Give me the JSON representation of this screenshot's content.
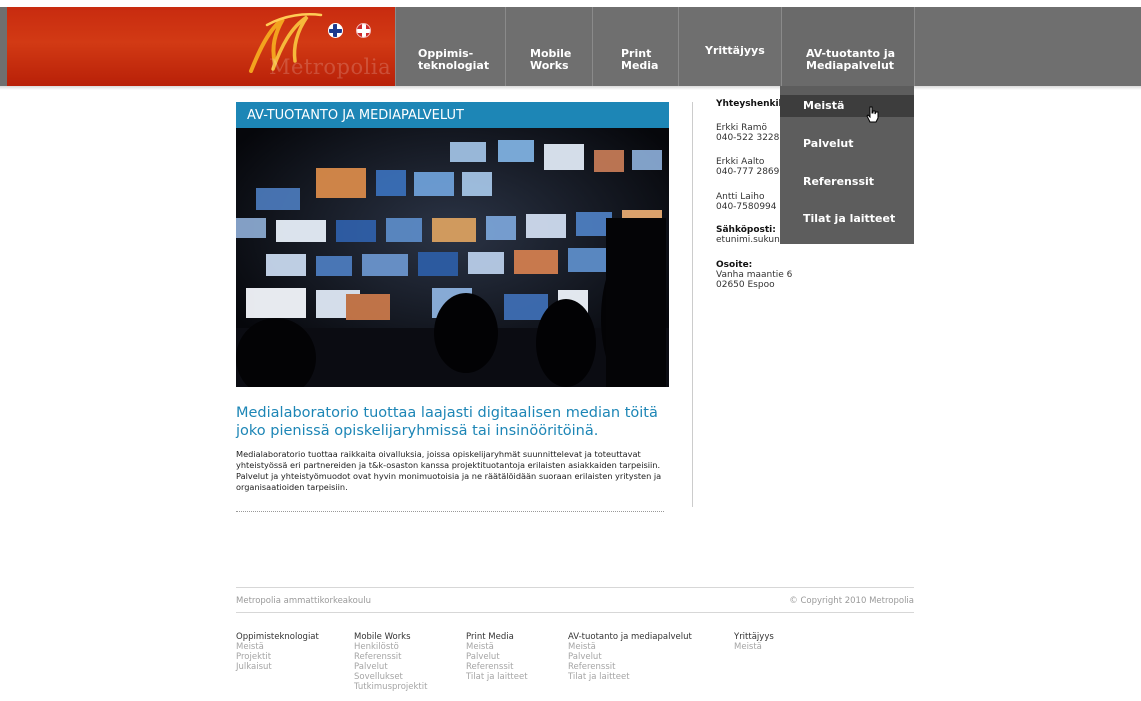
{
  "brand": {
    "logo_text": "Metropolia"
  },
  "languages": [
    {
      "name": "finnish-flag"
    },
    {
      "name": "english-flag"
    }
  ],
  "nav": {
    "items": [
      {
        "label": "Oppimis-\nteknologiat"
      },
      {
        "label": "Mobile\nWorks"
      },
      {
        "label": "Print\nMedia"
      },
      {
        "label": "Yrittäjyys"
      },
      {
        "label": "AV-tuotanto ja\nMediapalvelut"
      }
    ]
  },
  "dropdown": {
    "items": [
      {
        "label": "Meistä",
        "active": true
      },
      {
        "label": "Palvelut"
      },
      {
        "label": "Referenssit"
      },
      {
        "label": "Tilat ja laitteet"
      }
    ]
  },
  "main": {
    "section_title": "AV-TUOTANTO JA MEDIAPALVELUT",
    "lead": "Medialaboratorio tuottaa laajasti digitaalisen median töitä joko pienissä opiskelijaryhmissä tai insinööritöinä.",
    "body": "Medialaboratorio tuottaa raikkaita oivalluksia, joissa opiskelijaryhmät suunnittelevat ja toteuttavat yhteistyössä eri partnereiden ja t&k-osaston kanssa projektituotantoja erilaisten asiakkaiden tarpeisiin. Palvelut ja yhteistyömuodot ovat hyvin monimuotoisia ja ne räätälöidään suoraan erilaisten yritysten ja organisaatioiden tarpeisiin."
  },
  "contacts": {
    "heading": "Yhteyshenkilöt:",
    "people": [
      {
        "name": "Erkki Ramö",
        "phone": "040-522 3228"
      },
      {
        "name": "Erkki Aalto",
        "phone": "040-777 2869"
      },
      {
        "name": "Antti Laiho",
        "phone": "040-7580994"
      }
    ],
    "email_label": "Sähköposti:",
    "email": "etunimi.sukunimi@metropolia.fi",
    "address_label": "Osoite:",
    "address_line1": "Vanha maantie 6",
    "address_line2": "02650 Espoo"
  },
  "footer": {
    "org": "Metropolia ammattikorkeakoulu",
    "copyright": "© Copyright 2010 Metropolia",
    "columns": [
      {
        "heading": "Oppimisteknologiat",
        "links": [
          "Meistä",
          "Projektit",
          "Julkaisut"
        ]
      },
      {
        "heading": "Mobile Works",
        "links": [
          "Henkilöstö",
          "Referenssit",
          "Palvelut",
          "Sovellukset",
          "Tutkimusprojektit"
        ]
      },
      {
        "heading": "Print Media",
        "links": [
          "Meistä",
          "Palvelut",
          "Referenssit",
          "Tilat ja laitteet"
        ]
      },
      {
        "heading": "AV-tuotanto ja mediapalvelut",
        "links": [
          "Meistä",
          "Palvelut",
          "Referenssit",
          "Tilat ja laitteet"
        ]
      },
      {
        "heading": "Yrittäjyys",
        "links": [
          "Meistä"
        ]
      }
    ]
  },
  "colors": {
    "header_red": "#c82b0f",
    "nav_gray": "#6f6f6f",
    "dropdown_gray": "#5d5d5d",
    "accent_blue": "#1d86b6"
  }
}
